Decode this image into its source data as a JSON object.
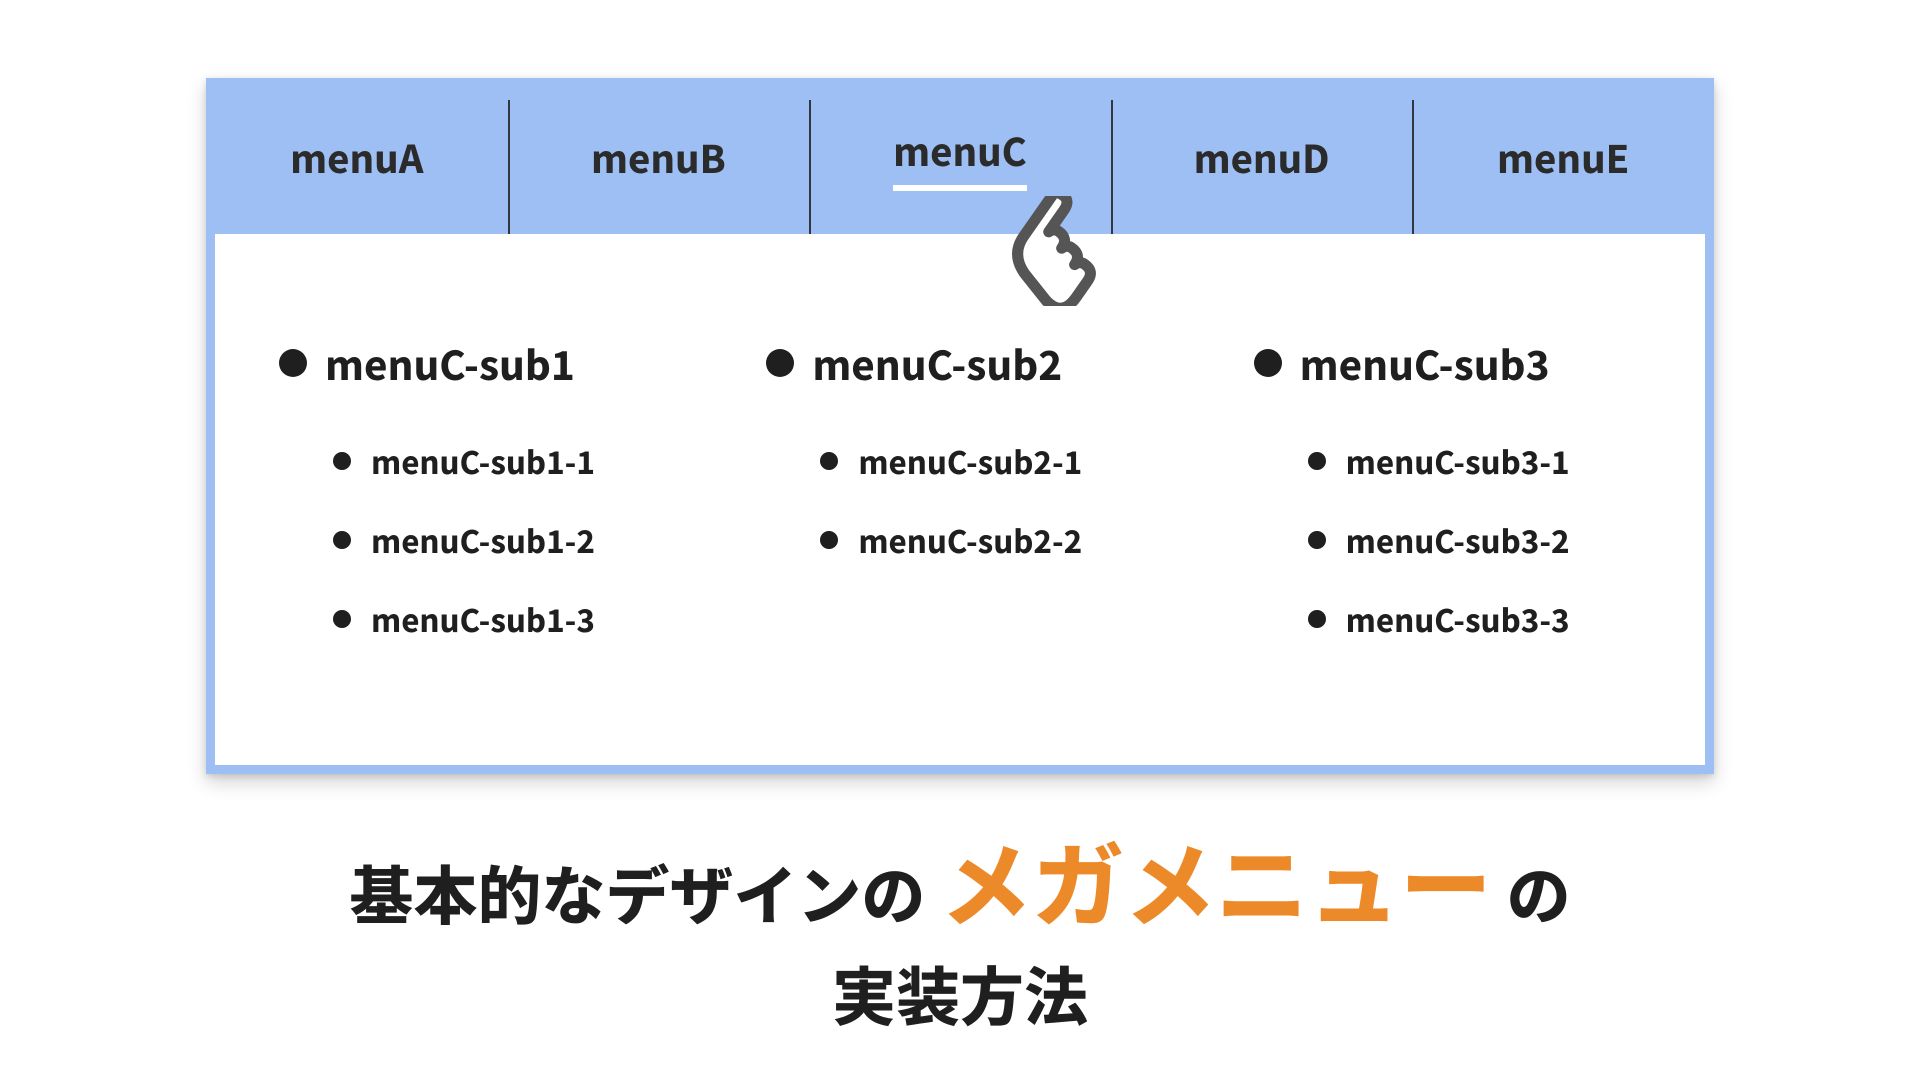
{
  "colors": {
    "menu_bg": "#9ebff3",
    "accent": "#ec8a2a",
    "text": "#2b2b2b"
  },
  "menu": {
    "items": [
      {
        "label": "menuA",
        "active": false
      },
      {
        "label": "menuB",
        "active": false
      },
      {
        "label": "menuC",
        "active": true
      },
      {
        "label": "menuD",
        "active": false
      },
      {
        "label": "menuE",
        "active": false
      }
    ]
  },
  "megaPanel": {
    "columns": [
      {
        "heading": "menuC-sub1",
        "items": [
          "menuC-sub1-1",
          "menuC-sub1-2",
          "menuC-sub1-3"
        ]
      },
      {
        "heading": "menuC-sub2",
        "items": [
          "menuC-sub2-1",
          "menuC-sub2-2"
        ]
      },
      {
        "heading": "menuC-sub3",
        "items": [
          "menuC-sub3-1",
          "menuC-sub3-2",
          "menuC-sub3-3"
        ]
      }
    ]
  },
  "cursor": {
    "semantic": "pointer-hand-icon"
  },
  "caption": {
    "prefix": "基本的なデザインの",
    "accent": "メガメニュー",
    "suffix": "の",
    "line2": "実装方法"
  }
}
